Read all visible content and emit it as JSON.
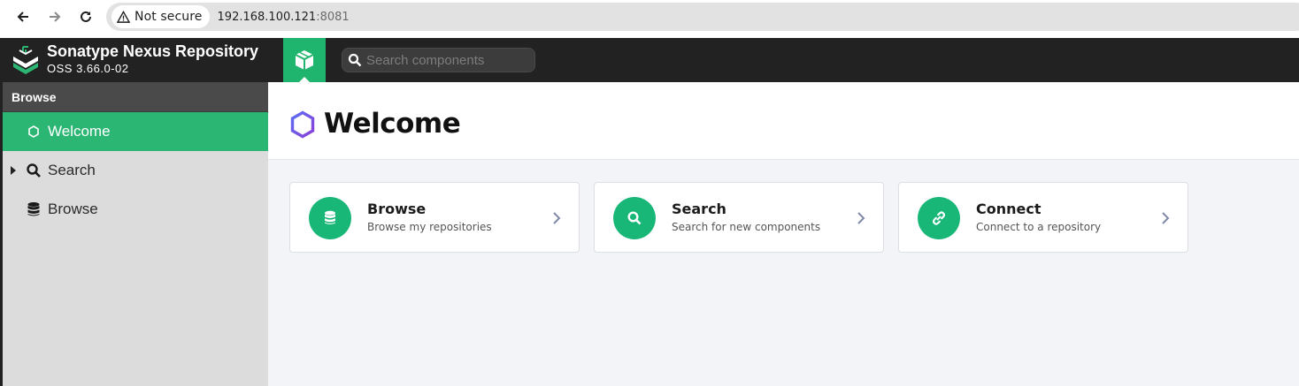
{
  "browser": {
    "security_label": "Not secure",
    "url_host": "192.168.100.121",
    "url_port": ":8081"
  },
  "header": {
    "brand_title": "Sonatype Nexus Repository",
    "brand_version": "OSS 3.66.0-02",
    "search_placeholder": "Search components",
    "accent_color": "#20b56e"
  },
  "sidebar": {
    "section_title": "Browse",
    "items": [
      {
        "label": "Welcome",
        "icon": "hexagon-icon",
        "active": true
      },
      {
        "label": "Search",
        "icon": "search-icon",
        "active": false,
        "expandable": true
      },
      {
        "label": "Browse",
        "icon": "database-icon",
        "active": false
      }
    ]
  },
  "main": {
    "title": "Welcome",
    "cards": [
      {
        "title": "Browse",
        "subtitle": "Browse my repositories",
        "icon": "database-icon"
      },
      {
        "title": "Search",
        "subtitle": "Search for new components",
        "icon": "search-icon"
      },
      {
        "title": "Connect",
        "subtitle": "Connect to a repository",
        "icon": "link-icon"
      }
    ]
  }
}
